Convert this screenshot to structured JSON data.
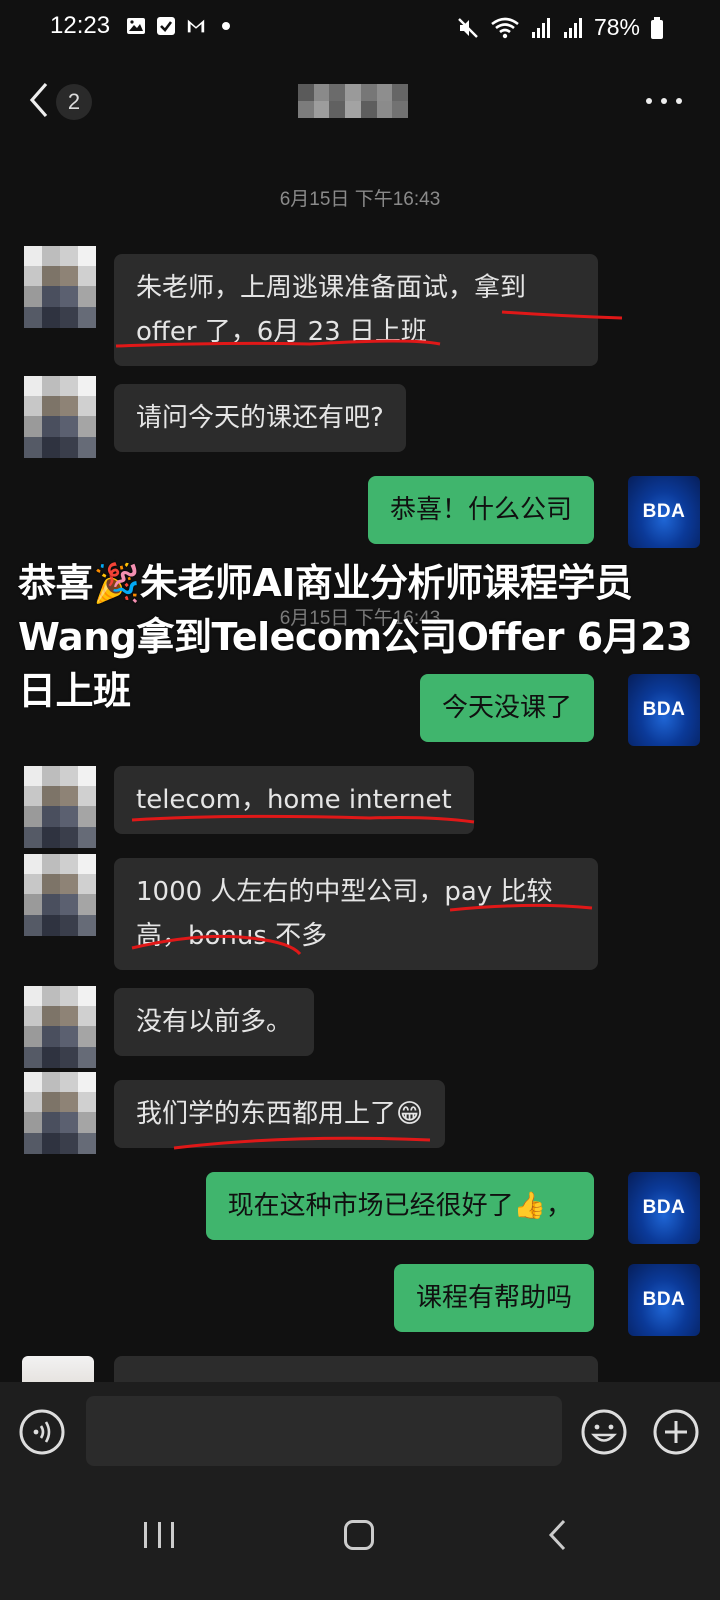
{
  "status_bar": {
    "time": "12:23",
    "battery": "78%",
    "left_icons": [
      "image-icon",
      "check-icon",
      "gmail-icon",
      "dot-icon"
    ],
    "right_icons": [
      "mute-icon",
      "wifi-icon",
      "signal-icon",
      "signal-icon",
      "battery-icon"
    ]
  },
  "header": {
    "unread_count": "2",
    "title_blurred": true
  },
  "timestamps": {
    "first": "6月15日 下午16:43",
    "ghost": "6月15日 下午16:43"
  },
  "messages": [
    {
      "side": "in",
      "text_line1": "朱老师，上周逃课准备面试，拿到",
      "text_line2": "offer 了，6月 23 日上班"
    },
    {
      "side": "in",
      "text": "请问今天的课还有吧?"
    },
    {
      "side": "out",
      "text": "恭喜！什么公司"
    },
    {
      "side": "out",
      "text": "今天没课了"
    },
    {
      "side": "in",
      "text": "telecom，home internet"
    },
    {
      "side": "in",
      "text_line1": "1000 人左右的中型公司，pay 比较",
      "text_line2": "高，bonus 不多"
    },
    {
      "side": "in",
      "text": "没有以前多。"
    },
    {
      "side": "in",
      "text": "我们学的东西都用上了😁"
    },
    {
      "side": "out",
      "text": "现在这种市场已经很好了👍，"
    },
    {
      "side": "out",
      "text": "课程有帮助吗"
    }
  ],
  "avatar_label": "BDA",
  "overlay_caption": {
    "line1": "恭喜🎉朱老师AI商业分析师课程学员",
    "line2": "Wang拿到Telecom公司Offer 6月23",
    "line3": "日上班"
  },
  "input": {
    "placeholder": ""
  },
  "colors": {
    "background": "#111111",
    "incoming_bubble": "#2c2c2c",
    "outgoing_bubble": "#40b56d",
    "underline": "#e01818",
    "bda_avatar": "#0b3a99"
  }
}
